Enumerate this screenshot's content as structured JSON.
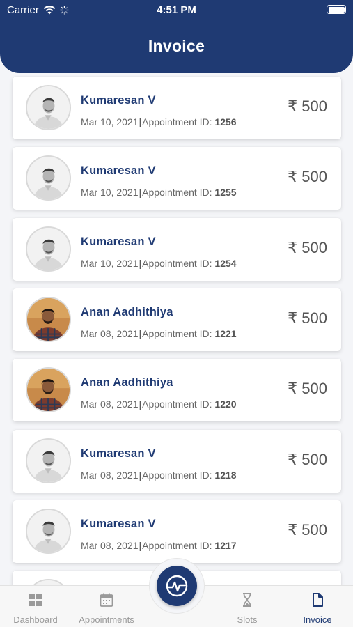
{
  "status_bar": {
    "carrier": "Carrier",
    "time": "4:51 PM"
  },
  "header": {
    "title": "Invoice"
  },
  "currency_symbol": "₹",
  "meta_separator": "|",
  "appointment_label": "Appointment ID:",
  "invoices": [
    {
      "name": "Kumaresan V",
      "date": "Mar 10, 2021",
      "appointment_id": "1256",
      "amount": "500",
      "avatar": "grayscale-man-portrait"
    },
    {
      "name": "Kumaresan V",
      "date": "Mar 10, 2021",
      "appointment_id": "1255",
      "amount": "500",
      "avatar": "grayscale-man-portrait"
    },
    {
      "name": "Kumaresan V",
      "date": "Mar 10, 2021",
      "appointment_id": "1254",
      "amount": "500",
      "avatar": "grayscale-man-portrait"
    },
    {
      "name": "Anan Aadhithiya",
      "date": "Mar 08, 2021",
      "appointment_id": "1221",
      "amount": "500",
      "avatar": "color-man-portrait"
    },
    {
      "name": "Anan Aadhithiya",
      "date": "Mar 08, 2021",
      "appointment_id": "1220",
      "amount": "500",
      "avatar": "color-man-portrait"
    },
    {
      "name": "Kumaresan V",
      "date": "Mar 08, 2021",
      "appointment_id": "1218",
      "amount": "500",
      "avatar": "grayscale-man-portrait"
    },
    {
      "name": "Kumaresan V",
      "date": "Mar 08, 2021",
      "appointment_id": "1217",
      "amount": "500",
      "avatar": "grayscale-man-portrait"
    }
  ],
  "bottom_nav": {
    "items": [
      {
        "label": "Dashboard",
        "icon": "grid-icon",
        "active": false
      },
      {
        "label": "Appointments",
        "icon": "calendar-icon",
        "active": false
      },
      {
        "label": "Slots",
        "icon": "hourglass-icon",
        "active": false
      },
      {
        "label": "Invoice",
        "icon": "document-icon",
        "active": true
      }
    ],
    "center_button_icon": "pulse-logo-icon"
  },
  "colors": {
    "primary": "#1f3a73",
    "background": "#f4f5f8",
    "inactive_nav": "#9a9a9a"
  }
}
